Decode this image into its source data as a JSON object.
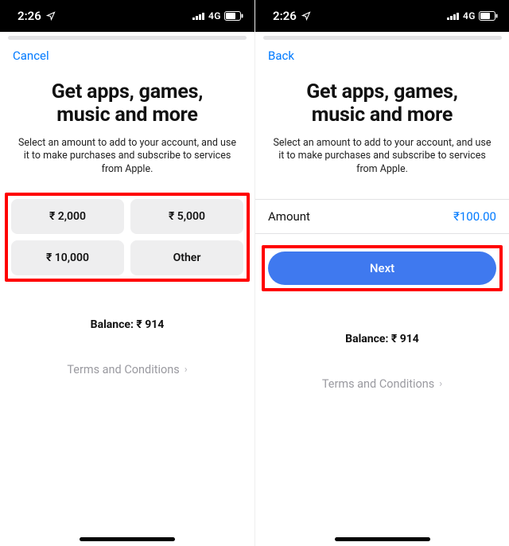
{
  "status": {
    "time": "2:26",
    "network": "4G"
  },
  "left": {
    "nav": "Cancel",
    "title_l1": "Get apps, games,",
    "title_l2": "music and more",
    "subtitle": "Select an amount to add to your account, and use it to make purchases and subscribe to services from Apple.",
    "amounts": [
      "₹ 2,000",
      "₹ 5,000",
      "₹ 10,000",
      "Other"
    ],
    "balance": "Balance: ₹ 914",
    "terms": "Terms and Conditions"
  },
  "right": {
    "nav": "Back",
    "title_l1": "Get apps, games,",
    "title_l2": "music and more",
    "subtitle": "Select an amount to add to your account, and use it to make purchases and subscribe to services from Apple.",
    "amount_label": "Amount",
    "amount_value": "₹100.00",
    "next": "Next",
    "balance": "Balance: ₹ 914",
    "terms": "Terms and Conditions"
  }
}
